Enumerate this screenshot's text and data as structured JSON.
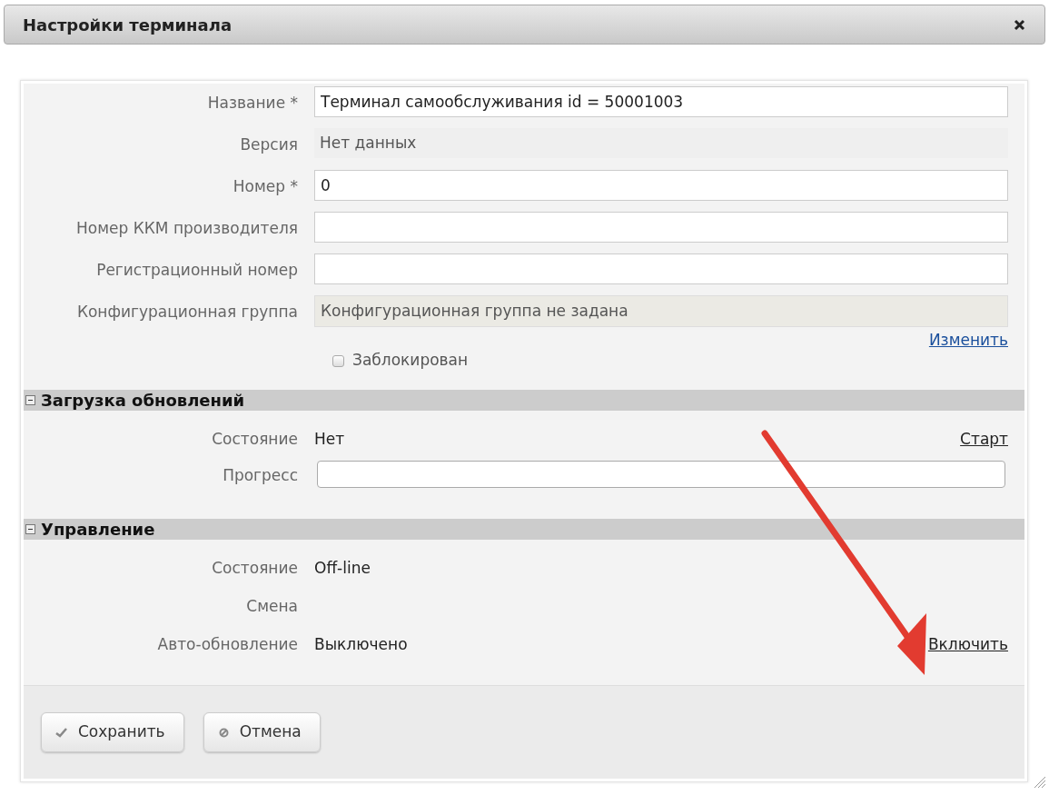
{
  "window": {
    "title": "Настройки терминала"
  },
  "fields": [
    {
      "kind": "input",
      "label": "Название *",
      "value": "Терминал самообслуживания id = 50001003"
    },
    {
      "kind": "text",
      "label": "Версия",
      "value": "Нет данных"
    },
    {
      "kind": "input",
      "label": "Номер *",
      "value": "0"
    },
    {
      "kind": "input",
      "label": "Номер ККМ производителя"
    },
    {
      "kind": "input",
      "label": "Регистрационный номер"
    },
    {
      "kind": "readonly",
      "label": "Конфигурационная группа",
      "value": "Конфигурационная группа не задана",
      "link": "Изменить"
    }
  ],
  "blocked": {
    "label": "Заблокирован",
    "checked": false
  },
  "sections": [
    {
      "title": "Загрузка обновлений",
      "expanded": true,
      "rows": [
        {
          "kind": "status",
          "label": "Состояние",
          "value": "Нет",
          "action": "Старт"
        },
        {
          "kind": "progress",
          "label": "Прогресс",
          "level": 0
        }
      ]
    },
    {
      "title": "Управление",
      "expanded": true,
      "rows": [
        {
          "kind": "status",
          "label": "Состояние",
          "value": "Off-line"
        },
        {
          "kind": "status",
          "label": "Смена"
        },
        {
          "kind": "status",
          "label": "Авто-обновление",
          "value": "Выключено",
          "action": "Включить"
        }
      ]
    }
  ],
  "buttons": [
    {
      "kind": "save",
      "label": "Сохранить"
    },
    {
      "kind": "cancel",
      "label": "Отмена"
    }
  ]
}
